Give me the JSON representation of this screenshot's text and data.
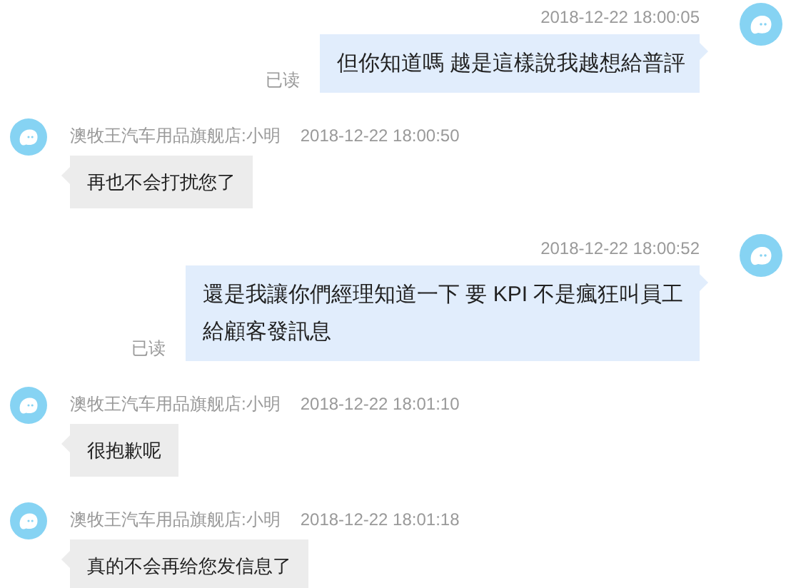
{
  "messages": [
    {
      "kind": "sent",
      "time": "2018-12-22 18:00:05",
      "text": "但你知道嗎 越是這樣說我越想給普評",
      "receipt": "已读"
    },
    {
      "kind": "received",
      "sender": "澳牧王汽车用品旗舰店:小明",
      "time": "2018-12-22 18:00:50",
      "text": "再也不会打扰您了"
    },
    {
      "kind": "sent",
      "time": "2018-12-22 18:00:52",
      "text": "還是我讓你們經理知道一下 要 KPI 不是瘋狂叫員工給顧客發訊息",
      "receipt": "已读"
    },
    {
      "kind": "received",
      "sender": "澳牧王汽车用品旗舰店:小明",
      "time": "2018-12-22 18:01:10",
      "text": "很抱歉呢"
    },
    {
      "kind": "received",
      "sender": "澳牧王汽车用品旗舰店:小明",
      "time": "2018-12-22 18:01:18",
      "text": "真的不会再给您发信息了"
    }
  ]
}
